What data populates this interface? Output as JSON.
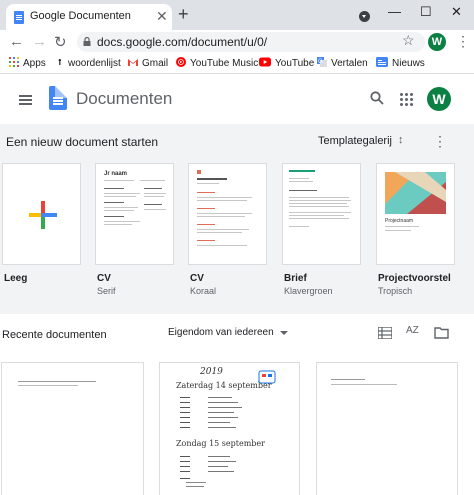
{
  "browser": {
    "tab_title": "Google Documenten",
    "new_tab_symbol": "+",
    "tab_close_symbol": "✕",
    "window_controls": {
      "minimize": "—",
      "maximize": "☐",
      "close": "✕"
    },
    "url": "docs.google.com/document/u/0/",
    "profile_initial": "W"
  },
  "bookmarks": [
    {
      "label": "Apps",
      "icon": "apps-grid-icon",
      "color": "#4285f4"
    },
    {
      "label": "woordenlijst",
      "icon": "bookmark-dot-icon",
      "color": "#202124"
    },
    {
      "label": "Gmail",
      "icon": "gmail-icon",
      "color": "#ea4335"
    },
    {
      "label": "YouTube Music",
      "icon": "youtube-music-icon",
      "color": "#ff0000"
    },
    {
      "label": "YouTube",
      "icon": "youtube-icon",
      "color": "#ff0000"
    },
    {
      "label": "Vertalen",
      "icon": "translate-icon",
      "color": "#4285f4"
    },
    {
      "label": "Nieuws",
      "icon": "news-icon",
      "color": "#4285f4"
    }
  ],
  "docs": {
    "app_title": "Documenten",
    "profile_initial": "W",
    "brand_color": "#4285f4"
  },
  "templates": {
    "heading": "Een nieuw document starten",
    "gallery_label": "Templategalerij",
    "items": [
      {
        "name": "Leeg",
        "subtitle": ""
      },
      {
        "name": "CV",
        "subtitle": "Serif"
      },
      {
        "name": "CV",
        "subtitle": "Koraal"
      },
      {
        "name": "Brief",
        "subtitle": "Klavergroen"
      },
      {
        "name": "Projectvoorstel",
        "subtitle": "Tropisch"
      }
    ],
    "thumb_text": {
      "cv_serif_name": "Jr naam",
      "proposal_title": "Projectnaam"
    }
  },
  "recent": {
    "heading": "Recente documenten",
    "owner_filter": "Eigendom van iedereen",
    "sort_label": "AZ",
    "doc2_year": "2019",
    "doc2_line1": "Zaterdag 14 september",
    "doc2_line2": "Zondag 15 september"
  }
}
